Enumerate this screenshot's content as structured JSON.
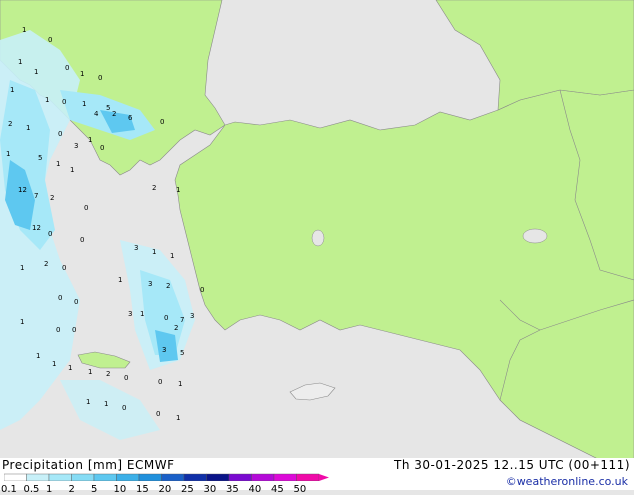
{
  "title": "Precipitation [mm]",
  "model": "ECMWF",
  "valid_time": "Th 30-01-2025 12..15 UTC (00+111)",
  "credit": "©weatheronline.co.uk",
  "colors": {
    "sea": "#e6e6e6",
    "land": "#c0f090",
    "neighbor_land": "#ededed",
    "border": "#8a8a8a"
  },
  "scale": {
    "ticks": [
      "0.1",
      "0.5",
      "1",
      "2",
      "5",
      "10",
      "15",
      "20",
      "25",
      "30",
      "35",
      "40",
      "45",
      "50"
    ],
    "colors": [
      "#ffffff",
      "#c8f0f8",
      "#a6e8f8",
      "#86dcf5",
      "#5ec8f0",
      "#3cb0e8",
      "#2090dc",
      "#1a60c8",
      "#1030a8",
      "#0a1488",
      "#7a0ad0",
      "#b40ad8",
      "#dc0ad8",
      "#f00aa8"
    ]
  },
  "station_values": [
    {
      "v": "1"
    },
    {
      "v": "0"
    },
    {
      "v": "1"
    },
    {
      "v": "0"
    },
    {
      "v": "1"
    },
    {
      "v": "1"
    },
    {
      "v": "1"
    },
    {
      "v": "0"
    },
    {
      "v": "1"
    },
    {
      "v": "0"
    },
    {
      "v": "1"
    },
    {
      "v": "5"
    },
    {
      "v": "4"
    },
    {
      "v": "2"
    },
    {
      "v": "6"
    },
    {
      "v": "0"
    },
    {
      "v": "2"
    },
    {
      "v": "1"
    },
    {
      "v": "0"
    },
    {
      "v": "1"
    },
    {
      "v": "1"
    },
    {
      "v": "5"
    },
    {
      "v": "3"
    },
    {
      "v": "0"
    },
    {
      "v": "1"
    },
    {
      "v": "1"
    },
    {
      "v": "12"
    },
    {
      "v": "7"
    },
    {
      "v": "2"
    },
    {
      "v": "1"
    },
    {
      "v": "2"
    },
    {
      "v": "12"
    },
    {
      "v": "0"
    },
    {
      "v": "0"
    },
    {
      "v": "0"
    },
    {
      "v": "2"
    },
    {
      "v": "0"
    },
    {
      "v": "1"
    },
    {
      "v": "3"
    },
    {
      "v": "1"
    },
    {
      "v": "1"
    },
    {
      "v": "0"
    },
    {
      "v": "0"
    },
    {
      "v": "3"
    },
    {
      "v": "1"
    },
    {
      "v": "0"
    },
    {
      "v": "2"
    },
    {
      "v": "1"
    },
    {
      "v": "3"
    },
    {
      "v": "3"
    },
    {
      "v": "0"
    },
    {
      "v": "2"
    },
    {
      "v": "7"
    },
    {
      "v": "0"
    },
    {
      "v": "3"
    },
    {
      "v": "1"
    },
    {
      "v": "0"
    },
    {
      "v": "1"
    },
    {
      "v": "5"
    },
    {
      "v": "1"
    },
    {
      "v": "1"
    },
    {
      "v": "1"
    },
    {
      "v": "2"
    },
    {
      "v": "0"
    },
    {
      "v": "0"
    },
    {
      "v": "1"
    },
    {
      "v": "1"
    },
    {
      "v": "1"
    },
    {
      "v": "0"
    },
    {
      "v": "0"
    },
    {
      "v": "1"
    }
  ]
}
